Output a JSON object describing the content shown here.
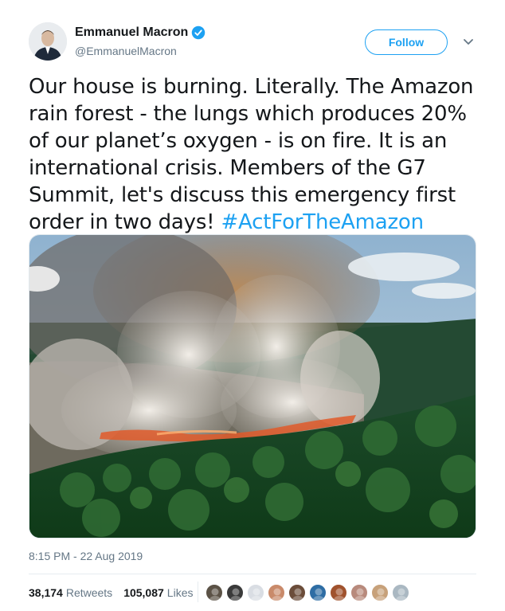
{
  "author": {
    "name": "Emmanuel Macron",
    "handle": "@EmmanuelMacron",
    "verified": true
  },
  "header": {
    "follow_label": "Follow",
    "menu_icon": "chevron-down-icon"
  },
  "tweet": {
    "text": "Our house is burning. Literally. The Amazon rain forest - the lungs which produces 20% of our planet’s oxygen - is on fire. It is an international crisis. Members of the G7 Summit, let's discuss this emergency first order in two days! ",
    "hashtag": "#ActForTheAmazon",
    "timestamp": "8:15 PM - 22 Aug 2019"
  },
  "stats": {
    "retweets_count": "38,174",
    "retweets_label": "Retweets",
    "likes_count": "105,087",
    "likes_label": "Likes"
  },
  "colors": {
    "accent": "#1da1f2",
    "secondary_text": "#657786"
  },
  "likers": [
    "#5b5246",
    "#3a3a3a",
    "#d9dde3",
    "#c98a6a",
    "#6b4d3a",
    "#2e6da4",
    "#a0522d",
    "#b88a7c",
    "#c7a17a",
    "#aab8c2"
  ]
}
